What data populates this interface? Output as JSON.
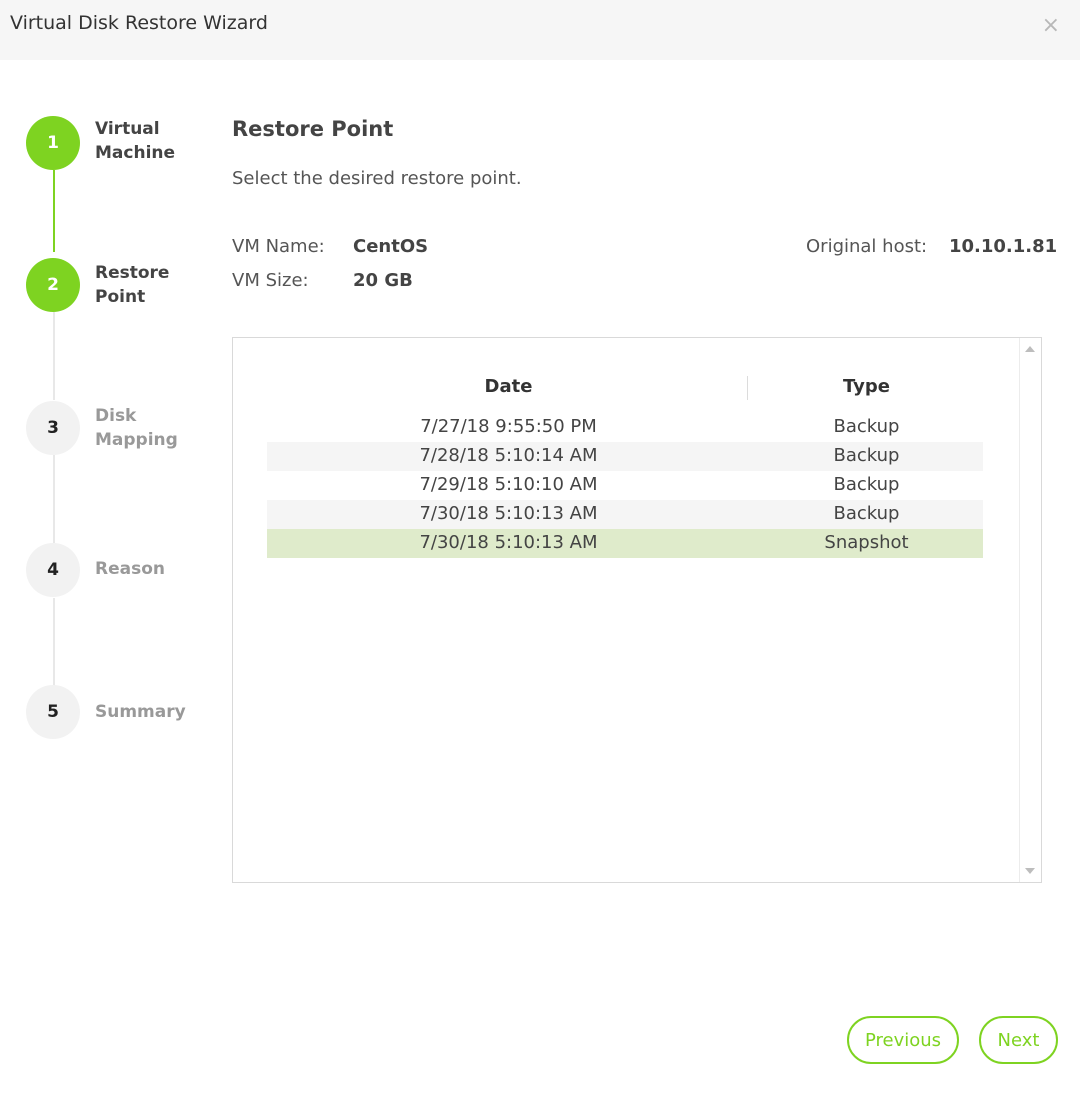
{
  "window": {
    "title": "Virtual Disk Restore Wizard",
    "close_icon": "×"
  },
  "steps": [
    {
      "number": "1",
      "label": "Virtual Machine",
      "state": "done"
    },
    {
      "number": "2",
      "label": "Restore Point",
      "state": "active"
    },
    {
      "number": "3",
      "label": "Disk Mapping",
      "state": "pending"
    },
    {
      "number": "4",
      "label": "Reason",
      "state": "pending"
    },
    {
      "number": "5",
      "label": "Summary",
      "state": "pending"
    }
  ],
  "content": {
    "title": "Restore Point",
    "description": "Select the desired restore point."
  },
  "vm_info": {
    "name_label": "VM Name:",
    "name_value": "CentOS",
    "size_label": "VM Size:",
    "size_value": "20 GB",
    "host_label": "Original host:",
    "host_value": "10.10.1.81"
  },
  "table": {
    "columns": [
      "Date",
      "Type"
    ],
    "rows": [
      {
        "date": "7/27/18 9:55:50 PM",
        "type": "Backup"
      },
      {
        "date": "7/28/18 5:10:14 AM",
        "type": "Backup"
      },
      {
        "date": "7/29/18 5:10:10 AM",
        "type": "Backup"
      },
      {
        "date": "7/30/18 5:10:13 AM",
        "type": "Backup"
      },
      {
        "date": "7/30/18 5:10:13 AM",
        "type": "Snapshot"
      }
    ],
    "selected_row": 4
  },
  "buttons": {
    "previous": "Previous",
    "next": "Next"
  },
  "colors": {
    "accent": "#7ed321",
    "selected_row": "#dfebcb",
    "alt_row": "#f5f5f5"
  }
}
